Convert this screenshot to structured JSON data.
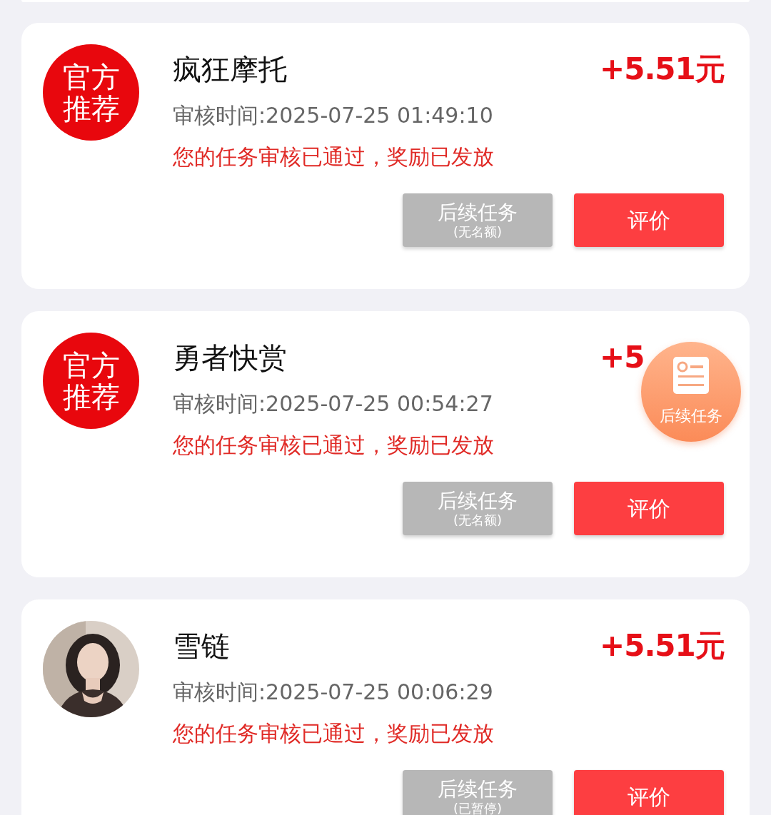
{
  "cards": [
    {
      "avatar": {
        "kind": "badge",
        "lines": [
          "官方",
          "推荐"
        ]
      },
      "title": "疯狂摩托",
      "amount": "+5.51元",
      "review_time": "审核时间:2025-07-25 01:49:10",
      "message": "您的任务审核已通过，奖励已发放",
      "buttons": [
        {
          "label": "后续任务",
          "sublabel": "(无名额)",
          "disabled": true
        },
        {
          "label": "评价",
          "disabled": false
        }
      ]
    },
    {
      "avatar": {
        "kind": "badge",
        "lines": [
          "官方",
          "推荐"
        ]
      },
      "title": "勇者快赏",
      "amount": "+5",
      "review_time": "审核时间:2025-07-25 00:54:27",
      "message": "您的任务审核已通过，奖励已发放",
      "buttons": [
        {
          "label": "后续任务",
          "sublabel": "(无名额)",
          "disabled": true
        },
        {
          "label": "评价",
          "disabled": false
        }
      ]
    },
    {
      "avatar": {
        "kind": "picture"
      },
      "title": "雪链",
      "amount": "+5.51元",
      "review_time": "审核时间:2025-07-25 00:06:29",
      "message": "您的任务审核已通过，奖励已发放",
      "buttons": [
        {
          "label": "后续任务",
          "sublabel": "(已暂停)",
          "disabled": true
        },
        {
          "label": "评价",
          "disabled": false
        }
      ]
    }
  ],
  "floating_button": {
    "label": "后续任务"
  }
}
